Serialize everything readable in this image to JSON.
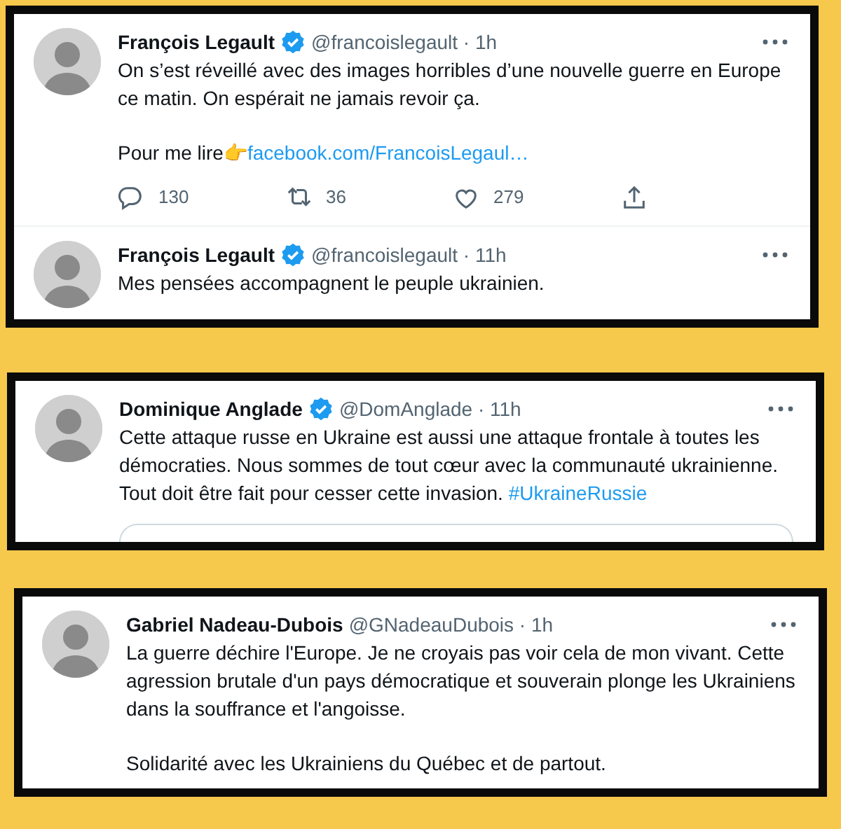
{
  "cards": [
    {
      "tweets": [
        {
          "name": "François Legault",
          "verified": true,
          "meta": "@francoislegault · 1h",
          "paragraphs": [
            [
              {
                "kind": "text",
                "text": "On s’est réveillé avec des images horribles d’une nouvelle guerre en Europe ce matin. On espérait ne jamais revoir ça."
              }
            ],
            [
              {
                "kind": "text",
                "text": "Pour me lire👉"
              },
              {
                "kind": "link",
                "text": "facebook.com/FrancoisLegaul…"
              }
            ]
          ],
          "actions": [
            {
              "kind": "reply",
              "count": "130"
            },
            {
              "kind": "retweet",
              "count": "36"
            },
            {
              "kind": "like",
              "count": "279"
            },
            {
              "kind": "share"
            }
          ]
        },
        {
          "name": "François Legault",
          "verified": true,
          "meta": "@francoislegault · 11h",
          "paragraphs": [
            [
              {
                "kind": "text",
                "text": "Mes pensées accompagnent le peuple ukrainien."
              }
            ]
          ]
        }
      ]
    },
    {
      "tweets": [
        {
          "name": "Dominique Anglade",
          "verified": true,
          "meta": "@DomAnglade · 11h",
          "paragraphs": [
            [
              {
                "kind": "text",
                "text": "Cette attaque russe en Ukraine est aussi une attaque frontale à toutes les démocraties. Nous sommes de tout cœur avec la communauté ukrainienne. Tout doit être fait pour cesser cette invasion. "
              },
              {
                "kind": "link",
                "text": "#UkraineRussie"
              }
            ]
          ],
          "quoted": true
        }
      ]
    },
    {
      "tweets": [
        {
          "name": "Gabriel Nadeau-Dubois",
          "verified": false,
          "meta": "@GNadeauDubois · 1h",
          "paragraphs": [
            [
              {
                "kind": "text",
                "text": "La guerre déchire l'Europe. Je ne croyais pas voir cela de mon vivant. Cette agression brutale d'un pays démocratique et souverain plonge les Ukrainiens dans la souffrance et l'angoisse."
              }
            ],
            [
              {
                "kind": "text",
                "text": "Solidarité avec les Ukrainiens du Québec et de partout."
              }
            ]
          ]
        }
      ]
    }
  ]
}
